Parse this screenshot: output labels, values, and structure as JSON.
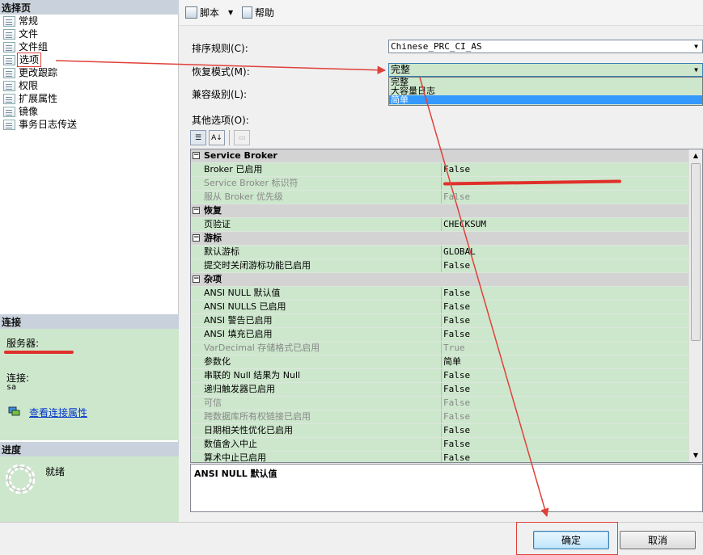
{
  "left": {
    "select_page_header": "选择页",
    "pages": [
      "常规",
      "文件",
      "文件组",
      "选项",
      "更改跟踪",
      "权限",
      "扩展属性",
      "镜像",
      "事务日志传送"
    ],
    "connection_header": "连接",
    "server_label": "服务器:",
    "connection_label": "连接:",
    "connection_user": "sa",
    "view_conn_props": "查看连接属性",
    "progress_header": "进度",
    "progress_status": "就绪"
  },
  "toolbar": {
    "script_label": "脚本",
    "help_label": "帮助"
  },
  "form": {
    "collation_label": "排序规则(C):",
    "collation_value": "Chinese_PRC_CI_AS",
    "recovery_label": "恢复模式(M):",
    "recovery_value": "完整",
    "recovery_options": [
      "完整",
      "大容量日志",
      "简单"
    ],
    "compat_label": "兼容级别(L):",
    "other_options_label": "其他选项(O):"
  },
  "grid": {
    "rows": [
      {
        "type": "cat",
        "name": "Service Broker"
      },
      {
        "type": "row",
        "name": "Broker 已启用",
        "value": "False"
      },
      {
        "type": "dis",
        "name": "Service Broker 标识符",
        "value": ""
      },
      {
        "type": "dis",
        "name": "服从 Broker 优先级",
        "value": "False"
      },
      {
        "type": "cat",
        "name": "恢复"
      },
      {
        "type": "row",
        "name": "页验证",
        "value": "CHECKSUM"
      },
      {
        "type": "cat",
        "name": "游标"
      },
      {
        "type": "row",
        "name": "默认游标",
        "value": "GLOBAL"
      },
      {
        "type": "row",
        "name": "提交时关闭游标功能已启用",
        "value": "False"
      },
      {
        "type": "cat",
        "name": "杂项"
      },
      {
        "type": "row",
        "name": "ANSI NULL 默认值",
        "value": "False"
      },
      {
        "type": "row",
        "name": "ANSI NULLS 已启用",
        "value": "False"
      },
      {
        "type": "row",
        "name": "ANSI 警告已启用",
        "value": "False"
      },
      {
        "type": "row",
        "name": "ANSI 填充已启用",
        "value": "False"
      },
      {
        "type": "dis",
        "name": "VarDecimal 存储格式已启用",
        "value": "True"
      },
      {
        "type": "row",
        "name": "参数化",
        "value": "简单"
      },
      {
        "type": "row",
        "name": "串联的 Null 结果为 Null",
        "value": "False"
      },
      {
        "type": "row",
        "name": "递归触发器已启用",
        "value": "False"
      },
      {
        "type": "dis",
        "name": "可信",
        "value": "False"
      },
      {
        "type": "dis",
        "name": "跨数据库所有权链接已启用",
        "value": "False"
      },
      {
        "type": "row",
        "name": "日期相关性优化已启用",
        "value": "False"
      },
      {
        "type": "row",
        "name": "数值舍入中止",
        "value": "False"
      },
      {
        "type": "row",
        "name": "算术中止已启用",
        "value": "False"
      }
    ],
    "description": "ANSI NULL 默认值"
  },
  "buttons": {
    "ok": "确定",
    "cancel": "取消"
  },
  "colors": {
    "annotation_red": "#e0403a",
    "panel_green": "#cde7cd",
    "highlight_blue": "#3399ff"
  }
}
